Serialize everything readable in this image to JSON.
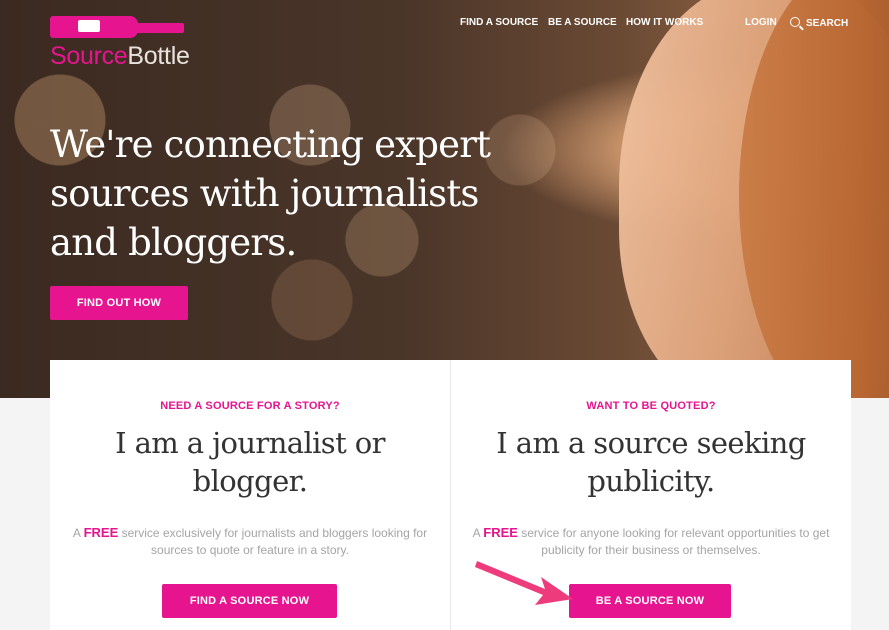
{
  "brand": {
    "part1": "Source",
    "part2": "Bottle",
    "accent_color": "#e6158f"
  },
  "nav": {
    "items": [
      "FIND A SOURCE",
      "BE A SOURCE",
      "HOW IT WORKS",
      "LOGIN",
      "SEARCH"
    ]
  },
  "hero": {
    "headline": "We're connecting expert sources with journalists and bloggers.",
    "cta_label": "FIND OUT HOW"
  },
  "cards": [
    {
      "eyebrow": "NEED A SOURCE FOR A STORY?",
      "title": "I am a journalist or blogger.",
      "desc_prefix": "A ",
      "desc_free": "FREE",
      "desc_rest": " service exclusively for journalists and bloggers looking for sources to quote or feature in a story.",
      "button": "FIND A SOURCE NOW"
    },
    {
      "eyebrow": "WANT TO BE QUOTED?",
      "title": "I am a source seeking publicity.",
      "desc_prefix": "A ",
      "desc_free": "FREE",
      "desc_rest": " service for anyone looking for relevant opportunities to get publicity for their business or themselves.",
      "button": "BE A SOURCE NOW"
    }
  ]
}
